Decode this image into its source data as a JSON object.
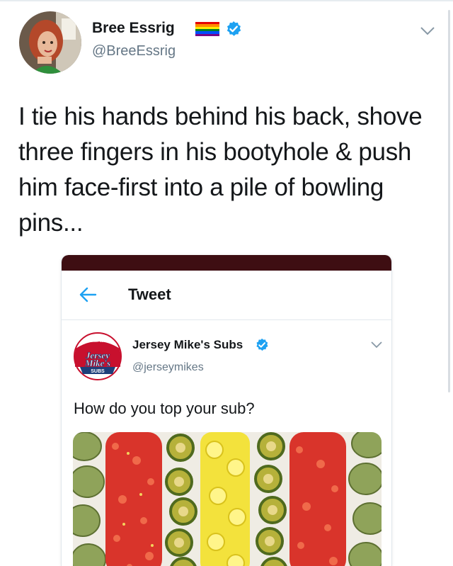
{
  "author": {
    "display_name": "Bree Essrig",
    "handle": "@BreeEssrig",
    "flag_icon": "rainbow-flag-icon",
    "verified_icon": "verified-badge-icon"
  },
  "tweet": {
    "text": "I tie his hands behind his back, shove three fingers in his bootyhole & push him face-first into a pile of bowling pins..."
  },
  "embedded": {
    "nav": {
      "back_icon": "back-arrow-icon",
      "title": "Tweet"
    },
    "author": {
      "display_name": "Jersey Mike's Subs",
      "handle": "@jerseymikes",
      "logo": {
        "since": "SINCE 1956",
        "line1": "Jersey",
        "line2": "Mike's",
        "subs": "SUBS"
      }
    },
    "text": "How do you top your sub?",
    "image_icon": "toppings-photo"
  },
  "colors": {
    "accent_blue": "#1da1f2",
    "text_primary": "#14171a",
    "text_secondary": "#657786",
    "maroon_bar": "#3e0e12"
  }
}
